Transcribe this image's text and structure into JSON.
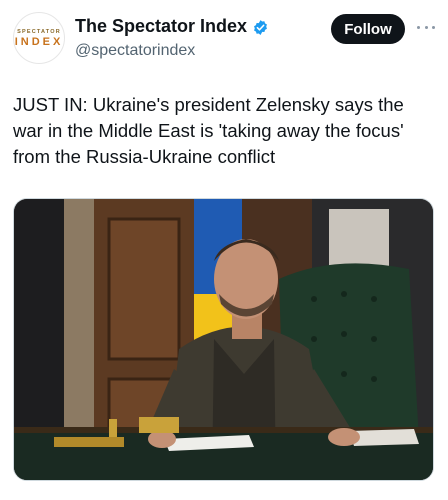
{
  "post": {
    "author": {
      "display_name": "The Spectator Index",
      "handle": "@spectatorindex",
      "avatar_top": "SPECTATOR",
      "avatar_main": "INDEX",
      "verified_icon": "verified-badge-icon",
      "verified_color": "#1d9bf0"
    },
    "follow_label": "Follow",
    "more_icon": "more-horizontal-icon",
    "text": "JUST IN: Ukraine's president Zelensky says the war in the Middle East is 'taking away the focus' from the Russia-Ukraine conflict"
  }
}
